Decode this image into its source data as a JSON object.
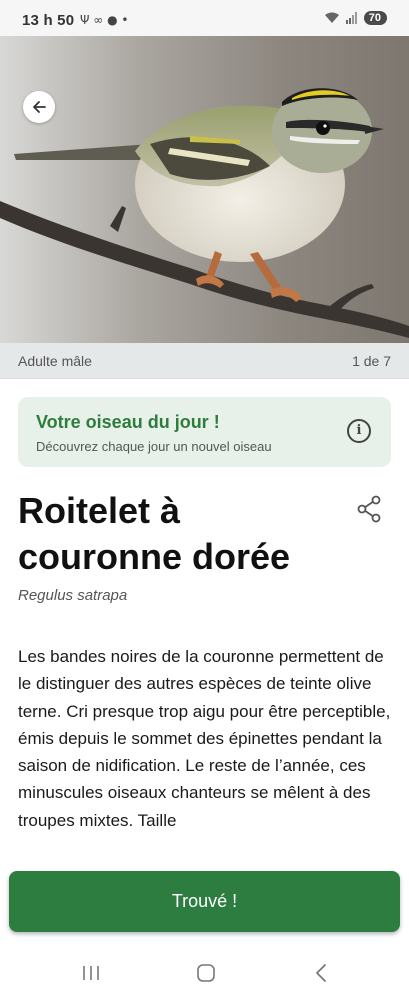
{
  "status_bar": {
    "time": "13 h 50",
    "notification_icons": "Ψ ∞ ● •",
    "battery_level": "70",
    "wifi_icon": "wifi-icon",
    "signal_icon": "signal-icon"
  },
  "hero": {
    "back_icon": "arrow-left-icon"
  },
  "photo_caption": {
    "label": "Adulte mâle",
    "counter": "1 de 7"
  },
  "daily_card": {
    "title": "Votre oiseau du jour !",
    "subtitle": "Découvrez chaque jour un nouvel oiseau",
    "info_icon": "info-icon"
  },
  "bird": {
    "common_name": "Roitelet à couronne dorée",
    "scientific_name": "Regulus satrapa",
    "description": "Les bandes noires de la couronne permettent de le distinguer des autres espèces de teinte olive terne. Cri presque trop aigu pour être perceptible, émis depuis le sommet des épinettes pendant la saison de nidification. Le reste de l’année, ces minuscules oiseaux chanteurs se mêlent à des troupes mixtes. Taille"
  },
  "actions": {
    "found_label": "Trouvé !",
    "share_icon": "share-icon"
  },
  "nav": {
    "recents_icon": "recents-icon",
    "home_icon": "home-icon",
    "back_icon": "back-icon"
  },
  "colors": {
    "accent_green": "#2e7d40",
    "card_bg": "#e7f1e9",
    "card_title": "#2e7d3c"
  }
}
